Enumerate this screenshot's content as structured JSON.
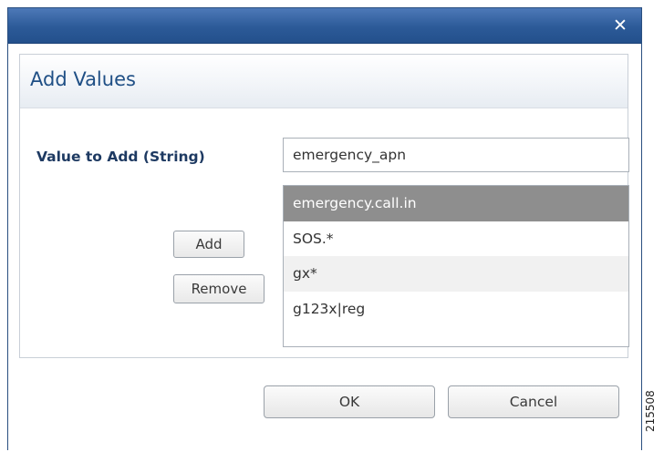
{
  "dialog": {
    "close_glyph": "✕"
  },
  "panel": {
    "title": "Add Values"
  },
  "form": {
    "value_label": "Value to Add (String)",
    "value_input": "emergency_apn",
    "add_label": "Add",
    "remove_label": "Remove"
  },
  "values_list": {
    "items": [
      {
        "label": "emergency.call.in",
        "selected": true
      },
      {
        "label": "SOS.*",
        "selected": false
      },
      {
        "label": "gx*",
        "selected": false
      },
      {
        "label": "g123x|reg",
        "selected": false
      }
    ]
  },
  "footer": {
    "ok_label": "OK",
    "cancel_label": "Cancel"
  },
  "figure_number": "215508",
  "colors": {
    "titlebar": "#2c5a98",
    "panel_title": "#1f4f85",
    "label": "#1e3a62",
    "selected_row": "#8e8e8e"
  }
}
